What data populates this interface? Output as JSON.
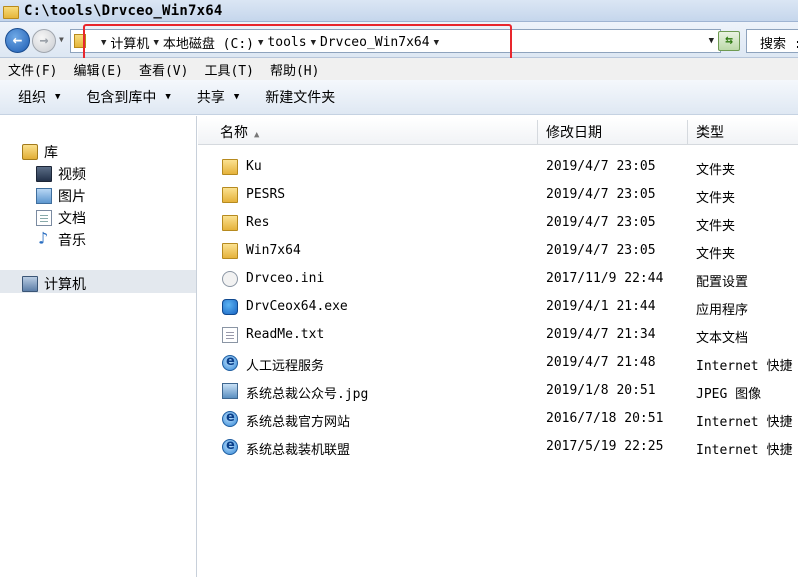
{
  "window": {
    "title": "C:\\tools\\Drvceo_Win7x64"
  },
  "addressbar": {
    "crumbs": [
      "计算机",
      "本地磁盘 (C:)",
      "tools",
      "Drvceo_Win7x64"
    ],
    "search_placeholder": "搜索 :"
  },
  "menu": {
    "items": [
      "文件(F)",
      "编辑(E)",
      "查看(V)",
      "工具(T)",
      "帮助(H)"
    ]
  },
  "toolbar": {
    "organize": "组织",
    "include_library": "包含到库中",
    "share": "共享",
    "new_folder": "新建文件夹"
  },
  "nav": {
    "library": "库",
    "library_items": [
      "视频",
      "图片",
      "文档",
      "音乐"
    ],
    "computer": "计算机"
  },
  "columns": {
    "name": "名称",
    "date": "修改日期",
    "type": "类型"
  },
  "files": [
    {
      "name": "Ku",
      "date": "2019/4/7 23:05",
      "type": "文件夹",
      "icon": "folder-icon"
    },
    {
      "name": "PESRS",
      "date": "2019/4/7 23:05",
      "type": "文件夹",
      "icon": "folder-icon"
    },
    {
      "name": "Res",
      "date": "2019/4/7 23:05",
      "type": "文件夹",
      "icon": "folder-icon"
    },
    {
      "name": "Win7x64",
      "date": "2019/4/7 23:05",
      "type": "文件夹",
      "icon": "folder-icon"
    },
    {
      "name": "Drvceo.ini",
      "date": "2017/11/9 22:44",
      "type": "配置设置",
      "icon": "settings-file-icon"
    },
    {
      "name": "DrvCeox64.exe",
      "date": "2019/4/1 21:44",
      "type": "应用程序",
      "icon": "application-icon"
    },
    {
      "name": "ReadMe.txt",
      "date": "2019/4/7 21:34",
      "type": "文本文档",
      "icon": "text-file-icon"
    },
    {
      "name": "人工远程服务",
      "date": "2019/4/7 21:48",
      "type": "Internet 快捷",
      "icon": "internet-shortcut-icon"
    },
    {
      "name": "系统总裁公众号.jpg",
      "date": "2019/1/8 20:51",
      "type": "JPEG 图像",
      "icon": "image-file-icon"
    },
    {
      "name": "系统总裁官方网站",
      "date": "2016/7/18 20:51",
      "type": "Internet 快捷",
      "icon": "internet-shortcut-icon"
    },
    {
      "name": "系统总裁装机联盟",
      "date": "2017/5/19 22:25",
      "type": "Internet 快捷",
      "icon": "internet-shortcut-icon"
    }
  ],
  "colors": {
    "highlight": "#e8262d",
    "selection": "#e3e8ee"
  }
}
